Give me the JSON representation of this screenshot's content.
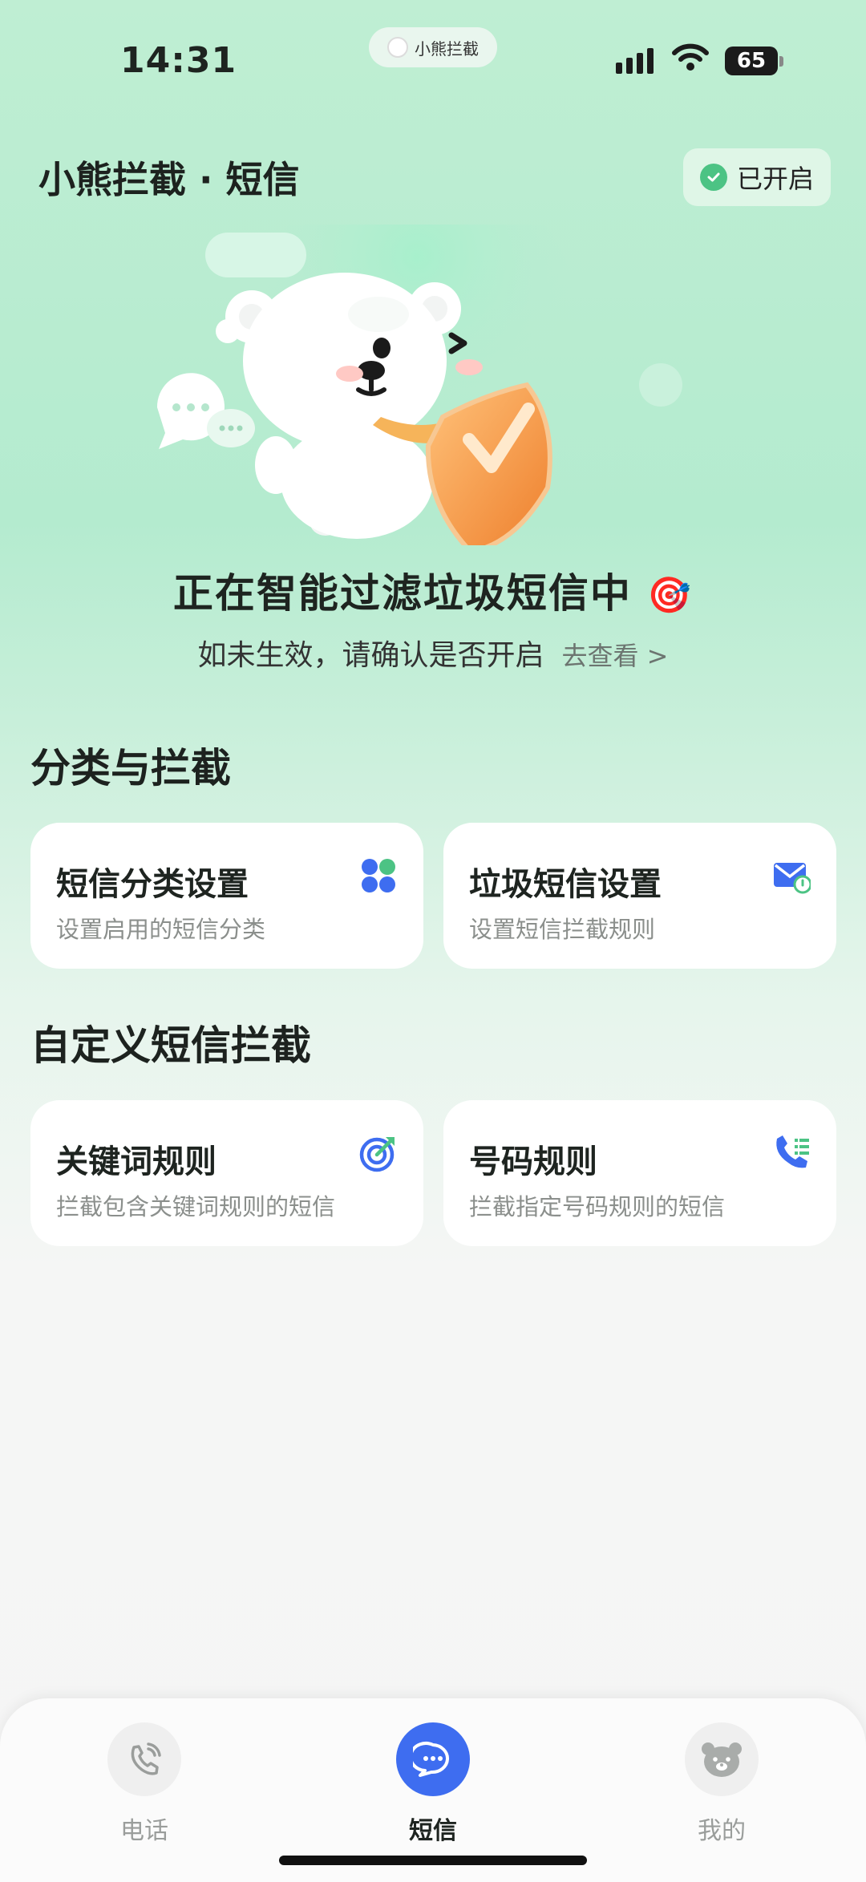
{
  "status_bar": {
    "time": "14:31",
    "island_label": "小熊拦截",
    "battery": "65"
  },
  "header": {
    "title": "小熊拦截 · 短信",
    "badge": "已开启"
  },
  "hero": {
    "title": "正在智能过滤垃圾短信中",
    "title_emoji": "🎯",
    "subtitle": "如未生效，请确认是否开启",
    "link": "去查看 >"
  },
  "section_classify": {
    "title": "分类与拦截",
    "cards": [
      {
        "title": "短信分类设置",
        "subtitle": "设置启用的短信分类",
        "icon": "four-leaf-grid-icon"
      },
      {
        "title": "垃圾短信设置",
        "subtitle": "设置短信拦截规则",
        "icon": "mail-clock-icon"
      }
    ]
  },
  "section_custom": {
    "title": "自定义短信拦截",
    "cards": [
      {
        "title": "关键词规则",
        "subtitle": "拦截包含关键词规则的短信",
        "icon": "target-icon"
      },
      {
        "title": "号码规则",
        "subtitle": "拦截指定号码规则的短信",
        "icon": "phone-list-icon"
      }
    ]
  },
  "tabbar": {
    "items": [
      {
        "label": "电话",
        "icon": "phone-icon",
        "active": false
      },
      {
        "label": "短信",
        "icon": "message-icon",
        "active": true
      },
      {
        "label": "我的",
        "icon": "bear-face-icon",
        "active": false
      }
    ]
  },
  "colors": {
    "accent_blue": "#3e6df0",
    "accent_green": "#4cc384",
    "shield_orange": "#f39a3e"
  }
}
